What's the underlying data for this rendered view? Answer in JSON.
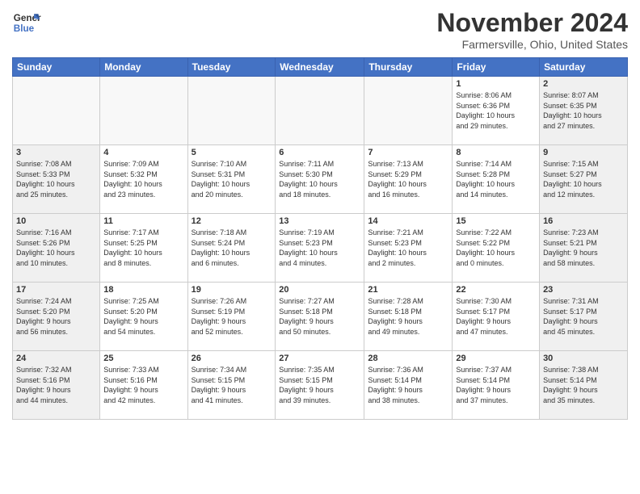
{
  "header": {
    "logo_line1": "General",
    "logo_line2": "Blue",
    "month": "November 2024",
    "location": "Farmersville, Ohio, United States"
  },
  "weekdays": [
    "Sunday",
    "Monday",
    "Tuesday",
    "Wednesday",
    "Thursday",
    "Friday",
    "Saturday"
  ],
  "weeks": [
    [
      {
        "day": "",
        "info": ""
      },
      {
        "day": "",
        "info": ""
      },
      {
        "day": "",
        "info": ""
      },
      {
        "day": "",
        "info": ""
      },
      {
        "day": "",
        "info": ""
      },
      {
        "day": "1",
        "info": "Sunrise: 8:06 AM\nSunset: 6:36 PM\nDaylight: 10 hours\nand 29 minutes."
      },
      {
        "day": "2",
        "info": "Sunrise: 8:07 AM\nSunset: 6:35 PM\nDaylight: 10 hours\nand 27 minutes."
      }
    ],
    [
      {
        "day": "3",
        "info": "Sunrise: 7:08 AM\nSunset: 5:33 PM\nDaylight: 10 hours\nand 25 minutes."
      },
      {
        "day": "4",
        "info": "Sunrise: 7:09 AM\nSunset: 5:32 PM\nDaylight: 10 hours\nand 23 minutes."
      },
      {
        "day": "5",
        "info": "Sunrise: 7:10 AM\nSunset: 5:31 PM\nDaylight: 10 hours\nand 20 minutes."
      },
      {
        "day": "6",
        "info": "Sunrise: 7:11 AM\nSunset: 5:30 PM\nDaylight: 10 hours\nand 18 minutes."
      },
      {
        "day": "7",
        "info": "Sunrise: 7:13 AM\nSunset: 5:29 PM\nDaylight: 10 hours\nand 16 minutes."
      },
      {
        "day": "8",
        "info": "Sunrise: 7:14 AM\nSunset: 5:28 PM\nDaylight: 10 hours\nand 14 minutes."
      },
      {
        "day": "9",
        "info": "Sunrise: 7:15 AM\nSunset: 5:27 PM\nDaylight: 10 hours\nand 12 minutes."
      }
    ],
    [
      {
        "day": "10",
        "info": "Sunrise: 7:16 AM\nSunset: 5:26 PM\nDaylight: 10 hours\nand 10 minutes."
      },
      {
        "day": "11",
        "info": "Sunrise: 7:17 AM\nSunset: 5:25 PM\nDaylight: 10 hours\nand 8 minutes."
      },
      {
        "day": "12",
        "info": "Sunrise: 7:18 AM\nSunset: 5:24 PM\nDaylight: 10 hours\nand 6 minutes."
      },
      {
        "day": "13",
        "info": "Sunrise: 7:19 AM\nSunset: 5:23 PM\nDaylight: 10 hours\nand 4 minutes."
      },
      {
        "day": "14",
        "info": "Sunrise: 7:21 AM\nSunset: 5:23 PM\nDaylight: 10 hours\nand 2 minutes."
      },
      {
        "day": "15",
        "info": "Sunrise: 7:22 AM\nSunset: 5:22 PM\nDaylight: 10 hours\nand 0 minutes."
      },
      {
        "day": "16",
        "info": "Sunrise: 7:23 AM\nSunset: 5:21 PM\nDaylight: 9 hours\nand 58 minutes."
      }
    ],
    [
      {
        "day": "17",
        "info": "Sunrise: 7:24 AM\nSunset: 5:20 PM\nDaylight: 9 hours\nand 56 minutes."
      },
      {
        "day": "18",
        "info": "Sunrise: 7:25 AM\nSunset: 5:20 PM\nDaylight: 9 hours\nand 54 minutes."
      },
      {
        "day": "19",
        "info": "Sunrise: 7:26 AM\nSunset: 5:19 PM\nDaylight: 9 hours\nand 52 minutes."
      },
      {
        "day": "20",
        "info": "Sunrise: 7:27 AM\nSunset: 5:18 PM\nDaylight: 9 hours\nand 50 minutes."
      },
      {
        "day": "21",
        "info": "Sunrise: 7:28 AM\nSunset: 5:18 PM\nDaylight: 9 hours\nand 49 minutes."
      },
      {
        "day": "22",
        "info": "Sunrise: 7:30 AM\nSunset: 5:17 PM\nDaylight: 9 hours\nand 47 minutes."
      },
      {
        "day": "23",
        "info": "Sunrise: 7:31 AM\nSunset: 5:17 PM\nDaylight: 9 hours\nand 45 minutes."
      }
    ],
    [
      {
        "day": "24",
        "info": "Sunrise: 7:32 AM\nSunset: 5:16 PM\nDaylight: 9 hours\nand 44 minutes."
      },
      {
        "day": "25",
        "info": "Sunrise: 7:33 AM\nSunset: 5:16 PM\nDaylight: 9 hours\nand 42 minutes."
      },
      {
        "day": "26",
        "info": "Sunrise: 7:34 AM\nSunset: 5:15 PM\nDaylight: 9 hours\nand 41 minutes."
      },
      {
        "day": "27",
        "info": "Sunrise: 7:35 AM\nSunset: 5:15 PM\nDaylight: 9 hours\nand 39 minutes."
      },
      {
        "day": "28",
        "info": "Sunrise: 7:36 AM\nSunset: 5:14 PM\nDaylight: 9 hours\nand 38 minutes."
      },
      {
        "day": "29",
        "info": "Sunrise: 7:37 AM\nSunset: 5:14 PM\nDaylight: 9 hours\nand 37 minutes."
      },
      {
        "day": "30",
        "info": "Sunrise: 7:38 AM\nSunset: 5:14 PM\nDaylight: 9 hours\nand 35 minutes."
      }
    ]
  ]
}
